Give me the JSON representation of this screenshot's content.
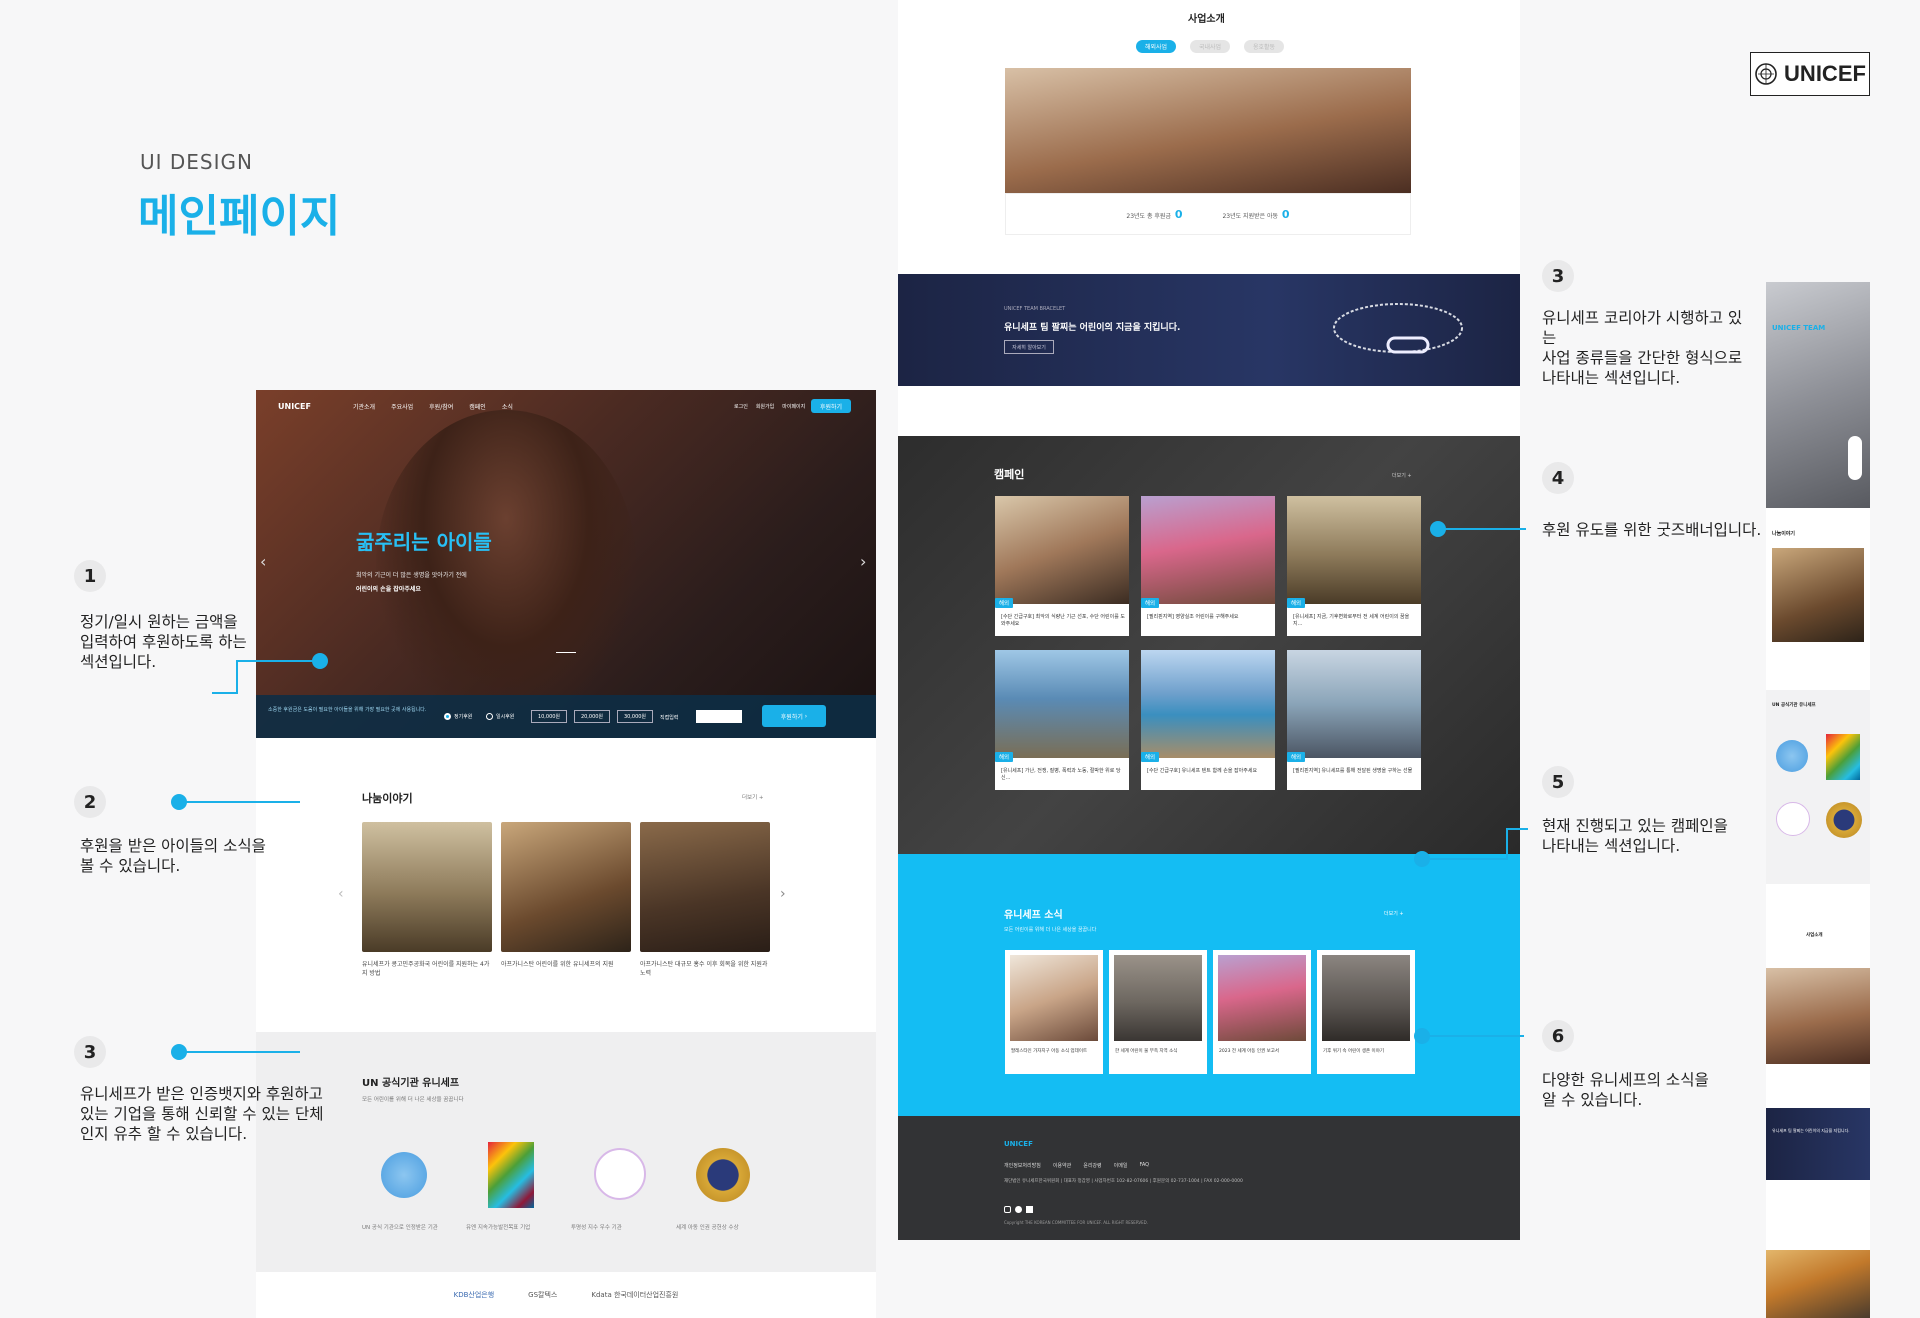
{
  "header": {
    "subtitle": "UI DESIGN",
    "title": "메인페이지"
  },
  "brand": {
    "logo_text": "UNICEF",
    "accent": "#1ab0e8"
  },
  "annotations": [
    {
      "num": "1",
      "text": "정기/일시 원하는 금액을\n입력하여 후원하도록 하는\n섹션입니다."
    },
    {
      "num": "2",
      "text": "후원을 받은 아이들의 소식을\n볼 수 있습니다."
    },
    {
      "num": "3",
      "text": "유니세프가 받은 인증뱃지와 후원하고\n있는 기업을 통해 신뢰할 수 있는 단체\n인지 유추 할 수 있습니다."
    },
    {
      "num": "3",
      "text": "유니세프 코리아가 시행하고 있는\n사업 종류들을 간단한 형식으로\n나타내는 섹션입니다."
    },
    {
      "num": "4",
      "text": "후원 유도를 위한 굿즈배너입니다."
    },
    {
      "num": "5",
      "text": "현재 진행되고 있는 캠페인을\n나타내는 섹션입니다."
    },
    {
      "num": "6",
      "text": "다양한 유니세프의 소식을\n알 수 있습니다."
    }
  ],
  "left_mock": {
    "logo": "UNICEF",
    "nav": [
      "기관소개",
      "주요사업",
      "후원/참여",
      "캠페인",
      "소식"
    ],
    "util": [
      "로그인",
      "회원가입",
      "마이페이지"
    ],
    "cta": "후원하기",
    "hero_title": "굶주리는 아이들",
    "hero_sub1": "최악의 기근이 더 많은 생명을 앗아가기 전에",
    "hero_sub2": "어린이의 손을 잡아주세요",
    "donate_text": "소중한 후원금은 도움이 필요한 아이들을 위해 가장 필요한 곳에 사용됩니다.",
    "donate_opts": [
      "정기후원",
      "일시후원"
    ],
    "amounts": [
      "10,000원",
      "20,000원",
      "30,000원"
    ],
    "custom": "직접입력",
    "donate_btn": "후원하기",
    "story_title": "나눔이야기",
    "more": "더보기 +",
    "stories": [
      "유니세프가 콩고민주공화국 어린이를 지원하는 4가지 방법",
      "아프가니스탄 어린이를 위한 유니세프의 지원",
      "아프가니스탄 대규모 홍수 이후 회복을 위한 지원과 노력"
    ],
    "un_title": "UN 공식기관 유니세프",
    "un_sub": "모든 어린이를 위해 더 나은 세상을 꿈꿉니다",
    "partners": [
      "KDB산업은행",
      "GS칼텍스",
      "Kdata 한국데이터산업진흥원"
    ]
  },
  "center_mock": {
    "biz_title": "사업소개",
    "tabs": [
      "해외사업",
      "국내사업",
      "옹호활동"
    ],
    "stat1_label": "23년도 총 후원금",
    "stat1_val": "0",
    "stat2_label": "23년도 지원받은 아동",
    "stat2_val": "0",
    "banner_small": "UNICEF TEAM BRACELET",
    "banner_title": "유니세프 팀 팔찌는 어린이의 지금을 지킵니다.",
    "banner_btn": "자세히 알아보기",
    "campaign_title": "캠페인",
    "more": "더보기 +",
    "tag": "해외",
    "campaigns": [
      "[수단 긴급구호] 최악의 식량난 기근 선포, 수단 어린이를 도와주세요",
      "[필리핀지역] 영양실조 어린이를 구해주세요",
      "[유니세프] 지금, 기후변화로부터 전 세계 어린이의 꿈을 지...",
      "[유니세프] 가난, 전쟁, 질병, 폭력과 노동, 절박한 위로 당신...",
      "[수단 긴급구호] 유니세프 텐트 함께 손을 잡아주세요",
      "[필리핀지역] 유니세프를 통해 전달된 생명을 구하는 선물"
    ],
    "news_title": "유니세프 소식",
    "news_sub": "모든 어린이를 위해 더 나은 세상을 꿈꿉니다",
    "news": [
      "팔레스타인 가자지구 아동 소식 업데이트",
      "한 세계 어린이 물 부족 지역 소식",
      "2023 전 세계 아동 인권 보고서",
      "기후 위기 속 어린이 생존 이야기"
    ],
    "footer_logo": "UNICEF",
    "footer_links": [
      "개인정보처리방침",
      "이용약관",
      "윤리강령",
      "이메일",
      "FAQ"
    ],
    "footer_addr": "재단법인 유니세프한국위원회 | 대표자 정갑영 | 사업자번호 102-82-07606 | 후원문의 02-737-1004 | FAX 02-000-0000",
    "footer_copy": "Copyright THE KOREAN COMMITTEE FOR UNICEF. ALL RIGHT RESERVED."
  },
  "right_mock": {
    "hero_title": "UNICEF TEAM",
    "story_title": "나눔이야기",
    "un_title": "UN 공식기관 유니세프",
    "biz_title": "사업소개",
    "banner_title": "유니세프 팀 팔찌는 어린이의 지금을 지킵니다."
  }
}
